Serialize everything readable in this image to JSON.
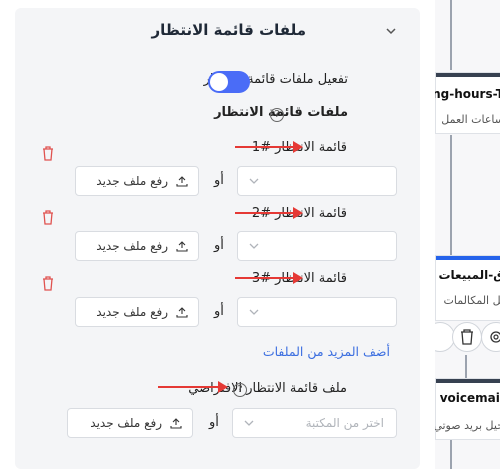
{
  "panel": {
    "section_title": "ملفات قائمة الانتظار",
    "toggle_label": "تفعيل ملفات قائمة الانتظار",
    "toggle_on": true,
    "subsection_title": "ملفات قائمة الانتظار",
    "help_glyph": "?",
    "queues": [
      {
        "label": "قائمة الانتظار #1",
        "or": "أو",
        "upload": "رفع ملف جديد"
      },
      {
        "label": "قائمة الانتظار #2",
        "or": "أو",
        "upload": "رفع ملف جديد"
      },
      {
        "label": "قائمة الانتظار #3",
        "or": "أو",
        "upload": "رفع ملف جديد"
      }
    ],
    "add_more": "أضف المزيد من الملفات",
    "default_label": "ملف قائمة الانتظار الافتراضي",
    "default_placeholder": "اختر من المكتبة",
    "default_or": "أو",
    "default_upload": "رفع ملف جديد"
  },
  "flow": {
    "nodes": [
      {
        "title": "rking-hours-T",
        "subtitle": "ساعات العمل",
        "bar_color": "#374151"
      },
      {
        "title": "ق-المبيعات",
        "subtitle": "يل المكالمات",
        "bar_color": "#2563eb"
      },
      {
        "title": "voicemail",
        "subtitle": "جيل بريد صوتي",
        "bar_color": "#374151"
      }
    ]
  },
  "colors": {
    "accent": "#4a6cf7",
    "link": "#3b6ee0",
    "danger": "#e53935",
    "trash": "#e0524f"
  },
  "icons": [
    "chevron-down-icon",
    "help-icon",
    "trash-icon",
    "upload-icon",
    "red-arrow-icon",
    "copy-icon",
    "gear-icon"
  ]
}
